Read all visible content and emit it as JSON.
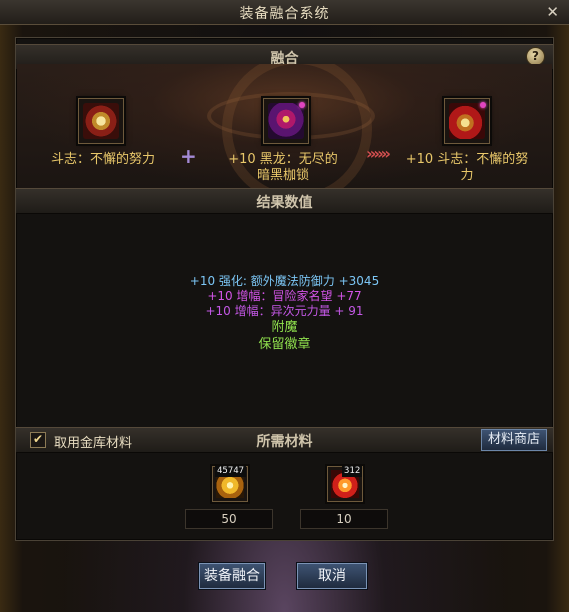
{
  "window": {
    "title": "装备融合系统",
    "close_glyph": "✕"
  },
  "fusion_section": {
    "title": "融合",
    "help_glyph": "?"
  },
  "items": {
    "left": {
      "name": "斗志：不懈的努力",
      "icon": "ring-gold-icon"
    },
    "middle": {
      "name_line1": "+10 黑龙：无尽的",
      "name_line2": "暗黑枷锁",
      "icon": "dragon-shackle-icon"
    },
    "right": {
      "name_line1": "+10 斗志：不懈的努",
      "name_line2": "力",
      "icon": "ring-result-icon"
    }
  },
  "plus_glyph": "+",
  "arrow_glyph": "»»»",
  "results_section": {
    "title": "结果数值",
    "lines": [
      "+10 强化: 额外魔法防御力 +3045",
      "+10 增幅：冒险家名望 +77",
      "+10 增幅：异次元力量 + 91",
      "附魔",
      "保留徽章"
    ],
    "colors": [
      "#7cc6f5",
      "#d455e8",
      "#c458e6",
      "#8fe04d",
      "#8fe04d"
    ]
  },
  "materials": {
    "use_vault_label": "取用金库材料",
    "use_vault_checked": true,
    "checkbox_glyph": "✔",
    "title": "所需材料",
    "shop_button": "材料商店",
    "items": [
      {
        "icon": "gold-crystal-icon",
        "stock_badge": "45747",
        "required": "50"
      },
      {
        "icon": "energy-burst-icon",
        "stock_badge": "312",
        "required": "10"
      }
    ]
  },
  "buttons": {
    "fuse": "装备融合",
    "cancel": "取消"
  }
}
